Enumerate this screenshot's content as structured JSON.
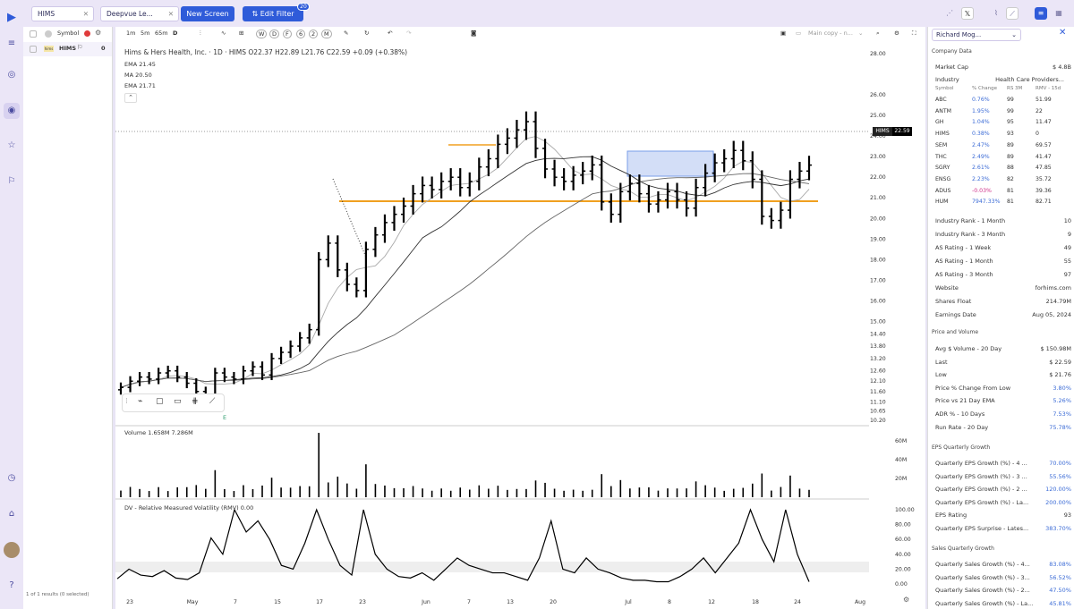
{
  "topbar": {
    "symbol_tab": "HIMS",
    "screen_tab": "Deepvue Le...",
    "new_screen": "New Screen",
    "edit_filter": "Edit Filter",
    "filter_count": "20",
    "user_label": "Richard Mog..."
  },
  "icons": {
    "close": "✕",
    "share": "share-icon",
    "twitter": "x-icon",
    "draw": "draw-icon",
    "grid": "grid-icon"
  },
  "watchlist": {
    "header": "Symbol",
    "row_symbol": "HIMS",
    "row_value": "0",
    "footer": "1 of 1 results (0 selected)"
  },
  "toolbar": {
    "timeframes": [
      "1m",
      "5m",
      "65m",
      "D"
    ],
    "periods": [
      "W",
      "D",
      "F",
      "6",
      "2",
      "M"
    ],
    "layout_label": "Main copy - n..."
  },
  "chart": {
    "title": "Hims & Hers Health, Inc. · 1D · HIMS",
    "ohlc": "O22.37  H22.89  L21.76  C22.59  +0.09 (+0.38%)",
    "indicators": [
      "EMA  21.45",
      "MA  20.50",
      "EMA  21.71"
    ],
    "price_tag_symbol": "HIMS",
    "price_tag_value": "22.59",
    "earnings_marker": "E"
  },
  "price_axis": [
    "28.00",
    "26.00",
    "25.00",
    "24.00",
    "23.00",
    "22.00",
    "21.00",
    "20.00",
    "19.00",
    "18.00",
    "17.00",
    "16.00",
    "15.00",
    "14.40",
    "13.80",
    "13.20",
    "12.60",
    "12.10",
    "11.60",
    "11.10",
    "10.65",
    "10.20"
  ],
  "volume": {
    "label": "Volume  1.658M  7.286M",
    "axis": [
      "60M",
      "40M",
      "20M"
    ]
  },
  "rmv": {
    "label": "DV - Relative Measured Volatility (RMV)  0.00",
    "axis": [
      "100.00",
      "80.00",
      "60.00",
      "40.00",
      "20.00",
      "0.00"
    ]
  },
  "date_axis": [
    "23",
    "May",
    "7",
    "15",
    "17",
    "23",
    "Jun",
    "7",
    "13",
    "20",
    "Jul",
    "8",
    "12",
    "18",
    "24",
    "Aug"
  ],
  "chart_data": {
    "type": "candlestick",
    "symbol": "HIMS",
    "ohlc_last": {
      "open": 22.37,
      "high": 22.89,
      "low": 21.76,
      "close": 22.59
    },
    "price_range": [
      10.2,
      28.0
    ],
    "volume_range_m": [
      0,
      60
    ],
    "rmv_range": [
      0,
      100
    ],
    "closes": [
      11.8,
      12.1,
      12.3,
      12.2,
      12.5,
      12.6,
      12.3,
      12.0,
      11.6,
      11.4,
      12.5,
      12.3,
      12.2,
      12.6,
      12.8,
      12.4,
      13.2,
      13.5,
      13.8,
      14.2,
      14.6,
      18.0,
      18.8,
      17.5,
      16.8,
      16.5,
      18.5,
      19.2,
      19.8,
      20.2,
      20.6,
      21.2,
      21.6,
      21.4,
      21.8,
      22.0,
      21.5,
      21.8,
      22.5,
      22.9,
      23.6,
      23.9,
      24.3,
      24.7,
      23.4,
      22.4,
      22.0,
      21.8,
      22.1,
      22.3,
      22.6,
      20.8,
      20.2,
      21.3,
      21.7,
      21.2,
      20.7,
      20.9,
      21.3,
      20.9,
      20.5,
      21.5,
      22.2,
      22.7,
      22.9,
      23.3,
      22.8,
      21.9,
      20.1,
      19.9,
      20.4,
      21.9,
      22.3,
      22.59
    ],
    "rmv": [
      7,
      20,
      12,
      10,
      18,
      8,
      6,
      15,
      62,
      40,
      100,
      70,
      85,
      60,
      25,
      20,
      55,
      100,
      60,
      25,
      12,
      100,
      40,
      20,
      10,
      8,
      15,
      5,
      20,
      35,
      25,
      20,
      15,
      15,
      10,
      5,
      35,
      85,
      20,
      15,
      35,
      20,
      15,
      8,
      5,
      5,
      3,
      3,
      10,
      20,
      35,
      15,
      35,
      55,
      100,
      60,
      30,
      100,
      40,
      3
    ]
  },
  "right_panel": {
    "company_header": "Company Data",
    "market_cap_label": "Market Cap",
    "market_cap": "$ 4.8B",
    "industry_label": "Industry",
    "industry": "Health Care Providers...",
    "peer_headers": [
      "Symbol",
      "% Change",
      "RS 3M",
      "RMV - 15d"
    ],
    "peers": [
      [
        "ABC",
        "0.76%",
        "99",
        "51.99"
      ],
      [
        "ANTM",
        "1.95%",
        "99",
        "22"
      ],
      [
        "GH",
        "1.04%",
        "95",
        "11.47"
      ],
      [
        "HIMS",
        "0.38%",
        "93",
        "0"
      ],
      [
        "SEM",
        "2.47%",
        "89",
        "69.57"
      ],
      [
        "THC",
        "2.49%",
        "89",
        "41.47"
      ],
      [
        "SGRY",
        "2.61%",
        "88",
        "47.85"
      ],
      [
        "ENSG",
        "2.23%",
        "82",
        "35.72"
      ],
      [
        "ADUS",
        "-0.03%",
        "81",
        "39.36"
      ],
      [
        "HUM",
        "7947.33%",
        "81",
        "82.71"
      ]
    ],
    "stats": [
      [
        "Industry Rank - 1 Month",
        "10"
      ],
      [
        "Industry Rank - 3 Month",
        "9"
      ],
      [
        "AS Rating - 1 Week",
        "49"
      ],
      [
        "AS Rating - 1 Month",
        "55"
      ],
      [
        "AS Rating - 3 Month",
        "97"
      ],
      [
        "Website",
        "forhims.com"
      ],
      [
        "Shares Float",
        "214.79M"
      ],
      [
        "Earnings Date",
        "Aug 05, 2024"
      ]
    ],
    "pv_header": "Price and Volume",
    "pv": [
      [
        "Avg $ Volume - 20 Day",
        "$ 150.98M"
      ],
      [
        "Last",
        "$ 22.59"
      ],
      [
        "Low",
        "$ 21.76"
      ],
      [
        "Price % Change From Low",
        "3.80%"
      ],
      [
        "Price vs 21 Day EMA",
        "5.26%"
      ],
      [
        "ADR % - 10 Days",
        "7.53%"
      ],
      [
        "Run Rate - 20 Day",
        "75.78%"
      ]
    ],
    "eps_header": "EPS Quarterly Growth",
    "eps": [
      [
        "Quarterly EPS Growth (%) - 4 ...",
        "70.00%"
      ],
      [
        "Quarterly EPS Growth (%) - 3 ...",
        "55.56%"
      ],
      [
        "Quarterly EPS Growth (%) - 2 ...",
        "120.00%"
      ],
      [
        "Quarterly EPS Growth (%) - La...",
        "200.00%"
      ],
      [
        "EPS Rating",
        "93"
      ],
      [
        "Quarterly EPS Surprise - Lates...",
        "383.70%"
      ]
    ],
    "sales_header": "Sales Quarterly Growth",
    "sales": [
      [
        "Quarterly Sales Growth (%) - 4...",
        "83.08%"
      ],
      [
        "Quarterly Sales Growth (%) - 3...",
        "56.52%"
      ],
      [
        "Quarterly Sales Growth (%) - 2...",
        "47.50%"
      ],
      [
        "Quarterly Sales Growth (%) - La...",
        "45.81%"
      ]
    ]
  },
  "colors": {
    "accent": "#2f5bd9",
    "orange_line": "#f0a020",
    "box": "#c8d6f5",
    "positive": "#3b6bd6",
    "negative": "#d0308a"
  }
}
